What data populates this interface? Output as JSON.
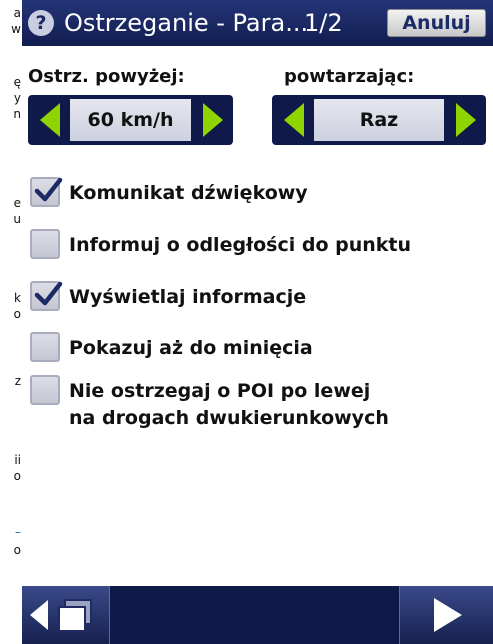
{
  "background_page": {
    "fragments": [
      "a",
      "w",
      "ę",
      "y",
      "n",
      "e",
      "u",
      "k",
      "o",
      "z",
      "ii",
      "o",
      "–",
      "o"
    ]
  },
  "titlebar": {
    "help_glyph": "?",
    "title": "Ostrzeganie - Para...",
    "page_indicator": "1/2",
    "cancel_label": "Anuluj"
  },
  "warn_above": {
    "label": "Ostrz. powyżej:",
    "value": "60 km/h"
  },
  "repeat": {
    "label": "powtarzając:",
    "value": "Raz"
  },
  "options": [
    {
      "label": "Komunikat dźwiękowy",
      "checked": true
    },
    {
      "label": "Informuj o odległości do punktu",
      "checked": false
    },
    {
      "label": "Wyświetlaj informacje",
      "checked": true
    },
    {
      "label": "Pokazuj aż do minięcia",
      "checked": false
    },
    {
      "label": "Nie ostrzegaj o POI po lewej",
      "label2": "na drogach dwukierunkowych",
      "checked": false
    }
  ],
  "colors": {
    "titlebar": "#1b2660",
    "arrow_green": "#8fd400",
    "check": "#1c2a66"
  }
}
